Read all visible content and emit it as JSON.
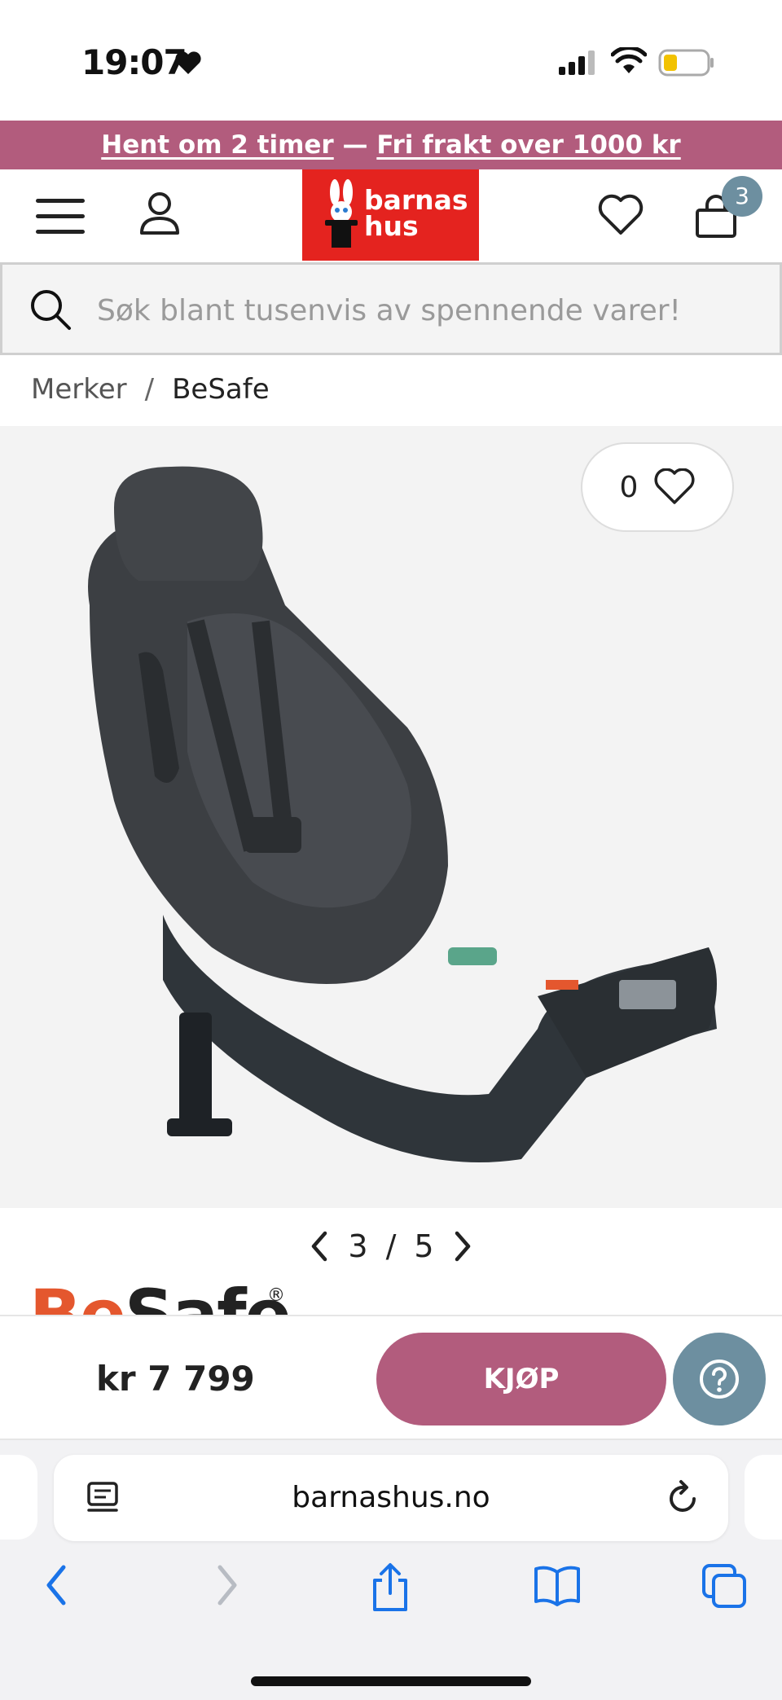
{
  "status_bar": {
    "time": "19:07",
    "icons": [
      "heart-icon",
      "signal-icon",
      "wifi-icon",
      "battery-icon"
    ]
  },
  "promo": {
    "link1": "Hent om 2 timer",
    "separator": " — ",
    "link2": "Fri frakt over 1000 kr"
  },
  "header": {
    "logo_line1": "barnas",
    "logo_line2": "hus",
    "cart_count": "3"
  },
  "search": {
    "placeholder": "Søk blant tusenvis av spennende varer!"
  },
  "breadcrumb": {
    "items": [
      "Merker",
      "BeSafe"
    ],
    "separator": "/"
  },
  "gallery": {
    "favorite_count": "0",
    "current": "3",
    "separator": "/",
    "total": "5"
  },
  "brand": {
    "name": "BeSafe",
    "name_part1": "Be",
    "name_part2": "Safe",
    "registered": "®"
  },
  "buybar": {
    "price": "kr 7 799",
    "buy_label": "KJØP"
  },
  "browser": {
    "url": "barnashus.no"
  },
  "colors": {
    "accent_pink": "#b25c7d",
    "accent_blue": "#6d8fa0",
    "logo_red": "#e4231f",
    "brand_orange": "#e4572e",
    "ios_blue": "#1a73e8"
  }
}
